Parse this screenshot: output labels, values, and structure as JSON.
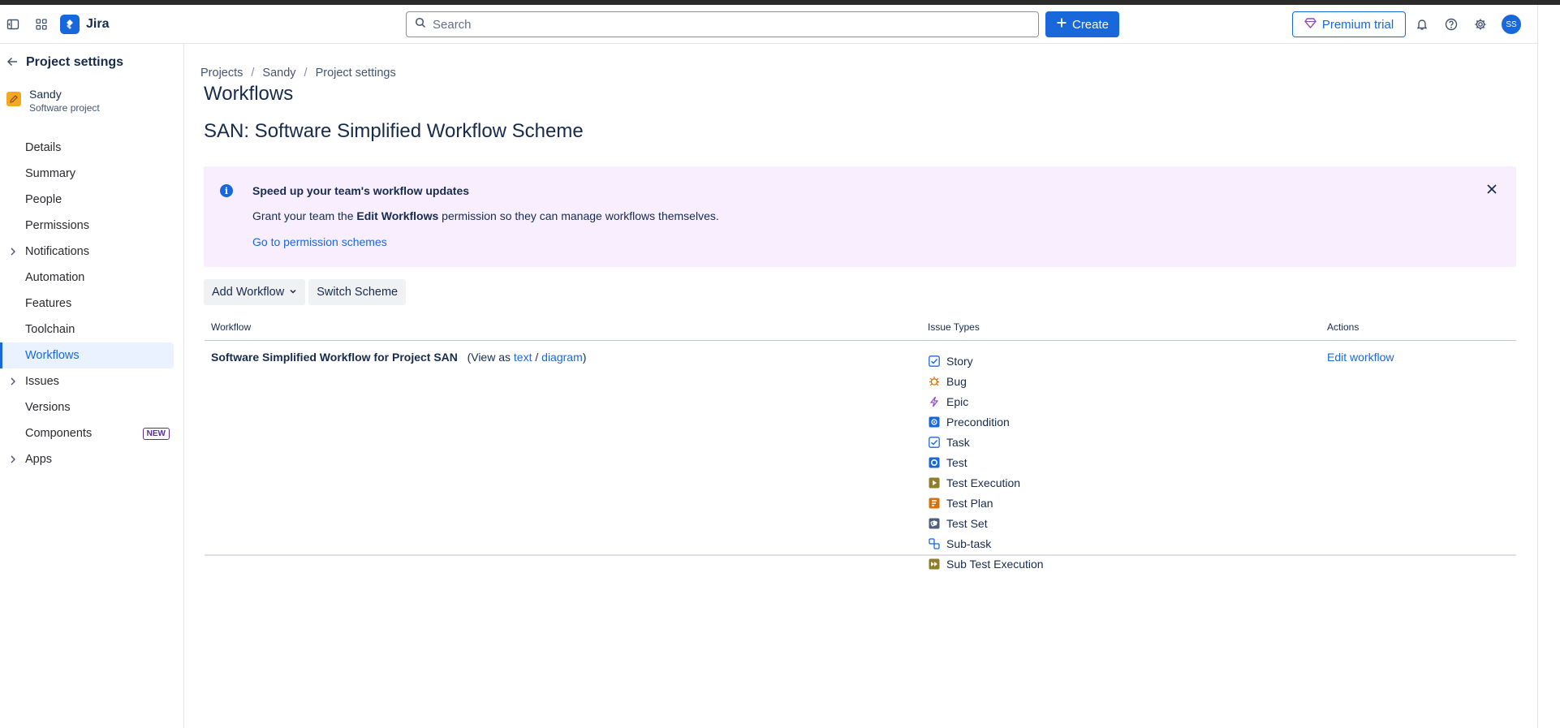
{
  "topnav": {
    "app_name": "Jira",
    "search_placeholder": "Search",
    "create_label": "Create",
    "premium_label": "Premium trial",
    "avatar_initials": "SS"
  },
  "sidebar": {
    "title": "Project settings",
    "project_name": "Sandy",
    "project_type": "Software project",
    "items": [
      {
        "label": "Details",
        "expandable": false,
        "active": false
      },
      {
        "label": "Summary",
        "expandable": false,
        "active": false
      },
      {
        "label": "People",
        "expandable": false,
        "active": false
      },
      {
        "label": "Permissions",
        "expandable": false,
        "active": false
      },
      {
        "label": "Notifications",
        "expandable": true,
        "active": false
      },
      {
        "label": "Automation",
        "expandable": false,
        "active": false
      },
      {
        "label": "Features",
        "expandable": false,
        "active": false
      },
      {
        "label": "Toolchain",
        "expandable": false,
        "active": false
      },
      {
        "label": "Workflows",
        "expandable": false,
        "active": true
      },
      {
        "label": "Issues",
        "expandable": true,
        "active": false
      },
      {
        "label": "Versions",
        "expandable": false,
        "active": false
      },
      {
        "label": "Components",
        "expandable": false,
        "active": false,
        "badge": "NEW"
      },
      {
        "label": "Apps",
        "expandable": true,
        "active": false
      }
    ]
  },
  "breadcrumbs": [
    "Projects",
    "Sandy",
    "Project settings"
  ],
  "page_title": "Workflows",
  "scheme_title": "SAN: Software Simplified Workflow Scheme",
  "banner": {
    "title": "Speed up your team's workflow updates",
    "body_prefix": "Grant your team the ",
    "body_bold": "Edit Workflows",
    "body_suffix": " permission so they can manage workflows themselves.",
    "link": "Go to permission schemes"
  },
  "buttons": {
    "add_workflow": "Add Workflow",
    "switch_scheme": "Switch Scheme"
  },
  "table": {
    "headers": [
      "Workflow",
      "Issue Types",
      "Actions"
    ],
    "row": {
      "workflow_name": "Software Simplified Workflow for Project SAN",
      "view_as_prefix": "(View as ",
      "view_text": "text",
      "view_sep": " / ",
      "view_diagram": "diagram",
      "view_as_suffix": ")",
      "action": "Edit workflow",
      "issue_types": [
        {
          "label": "Story",
          "icon": "story-icon",
          "color": "#1868db"
        },
        {
          "label": "Bug",
          "icon": "bug-icon",
          "color": "#e06c00"
        },
        {
          "label": "Epic",
          "icon": "epic-icon",
          "color": "#964ac0"
        },
        {
          "label": "Precondition",
          "icon": "precondition-icon",
          "color": "#1868db"
        },
        {
          "label": "Task",
          "icon": "task-icon",
          "color": "#1868db"
        },
        {
          "label": "Test",
          "icon": "test-icon",
          "color": "#1868db"
        },
        {
          "label": "Test Execution",
          "icon": "test-execution-icon",
          "color": "#8f7e2e"
        },
        {
          "label": "Test Plan",
          "icon": "test-plan-icon",
          "color": "#d97008"
        },
        {
          "label": "Test Set",
          "icon": "test-set-icon",
          "color": "#505f79"
        },
        {
          "label": "Sub-task",
          "icon": "subtask-icon",
          "color": "#1868db"
        },
        {
          "label": "Sub Test Execution",
          "icon": "sub-test-execution-icon",
          "color": "#8f7e2e"
        }
      ]
    }
  }
}
